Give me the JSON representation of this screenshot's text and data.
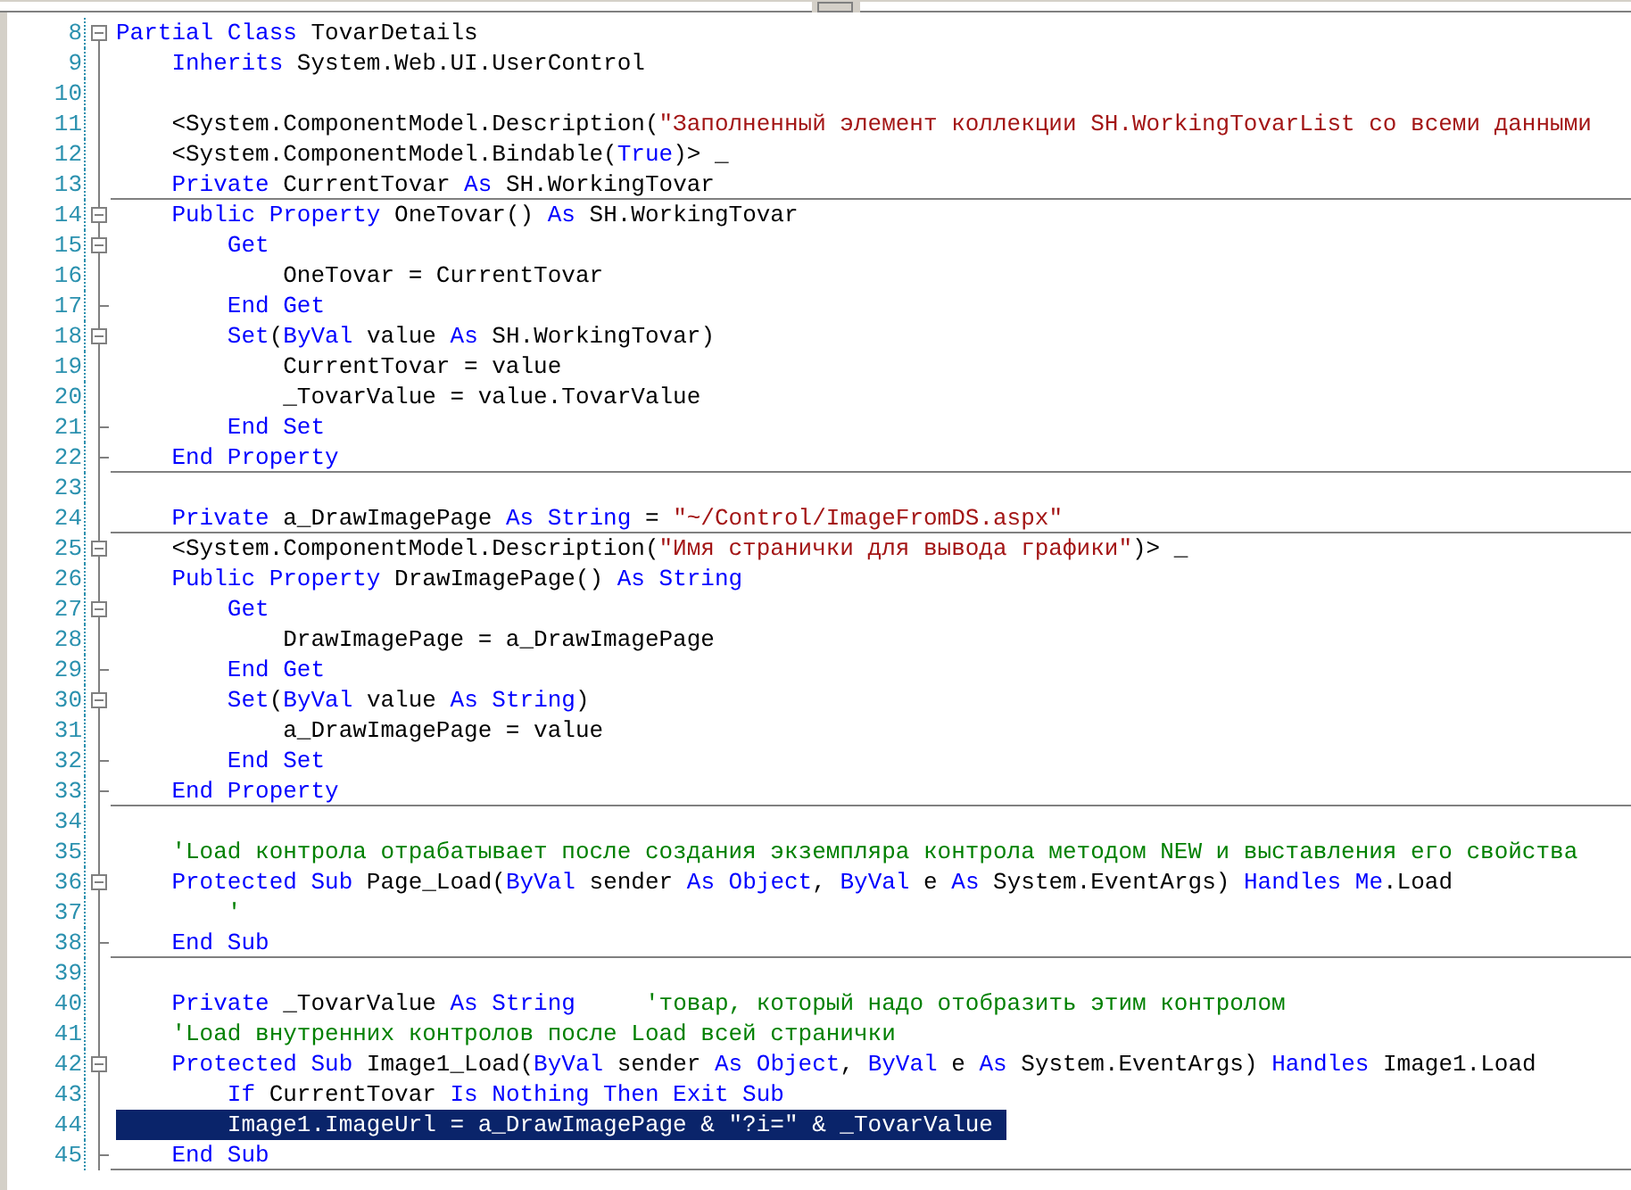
{
  "lines": [
    {
      "number": "8",
      "fold_box": true,
      "fold_end": false,
      "separator_below": false,
      "selected": false,
      "segments": [
        {
          "kind": "keyword",
          "text": "Partial Class"
        },
        {
          "kind": "plain",
          "text": " TovarDetails"
        }
      ]
    },
    {
      "number": "9",
      "fold_box": false,
      "fold_end": false,
      "separator_below": false,
      "selected": false,
      "segments": [
        {
          "kind": "keyword",
          "text": "    Inherits"
        },
        {
          "kind": "plain",
          "text": " System.Web.UI.UserControl"
        }
      ]
    },
    {
      "number": "10",
      "fold_box": false,
      "fold_end": false,
      "separator_below": false,
      "selected": false
    },
    {
      "number": "11",
      "fold_box": false,
      "fold_end": false,
      "separator_below": false,
      "selected": false,
      "segments": [
        {
          "kind": "plain",
          "text": "    <System.ComponentModel.Description("
        },
        {
          "kind": "string",
          "text": "\"Заполненный элемент коллекции SH.WorkingTovarList со всеми данными"
        }
      ]
    },
    {
      "number": "12",
      "fold_box": false,
      "fold_end": false,
      "separator_below": false,
      "selected": false,
      "segments": [
        {
          "kind": "plain",
          "text": "    <System.ComponentModel.Bindable("
        },
        {
          "kind": "keyword",
          "text": "True"
        },
        {
          "kind": "plain",
          "text": ")> _"
        }
      ]
    },
    {
      "number": "13",
      "fold_box": false,
      "fold_end": false,
      "separator_below": true,
      "selected": false,
      "segments": [
        {
          "kind": "keyword",
          "text": "    Private"
        },
        {
          "kind": "plain",
          "text": " CurrentTovar "
        },
        {
          "kind": "keyword",
          "text": "As"
        },
        {
          "kind": "plain",
          "text": " SH.WorkingTovar"
        }
      ]
    },
    {
      "number": "14",
      "fold_box": true,
      "fold_end": false,
      "separator_below": false,
      "selected": false,
      "segments": [
        {
          "kind": "keyword",
          "text": "    Public Property"
        },
        {
          "kind": "plain",
          "text": " OneTovar() "
        },
        {
          "kind": "keyword",
          "text": "As"
        },
        {
          "kind": "plain",
          "text": " SH.WorkingTovar"
        }
      ]
    },
    {
      "number": "15",
      "fold_box": true,
      "fold_end": false,
      "separator_below": false,
      "selected": false,
      "segments": [
        {
          "kind": "keyword",
          "text": "        Get"
        }
      ]
    },
    {
      "number": "16",
      "fold_box": false,
      "fold_end": false,
      "separator_below": false,
      "selected": false,
      "segments": [
        {
          "kind": "plain",
          "text": "            OneTovar = CurrentTovar"
        }
      ]
    },
    {
      "number": "17",
      "fold_box": false,
      "fold_end": true,
      "separator_below": false,
      "selected": false,
      "segments": [
        {
          "kind": "keyword",
          "text": "        End Get"
        }
      ]
    },
    {
      "number": "18",
      "fold_box": true,
      "fold_end": false,
      "separator_below": false,
      "selected": false,
      "segments": [
        {
          "kind": "keyword",
          "text": "        Set"
        },
        {
          "kind": "plain",
          "text": "("
        },
        {
          "kind": "keyword",
          "text": "ByVal"
        },
        {
          "kind": "plain",
          "text": " value "
        },
        {
          "kind": "keyword",
          "text": "As"
        },
        {
          "kind": "plain",
          "text": " SH.WorkingTovar)"
        }
      ]
    },
    {
      "number": "19",
      "fold_box": false,
      "fold_end": false,
      "separator_below": false,
      "selected": false,
      "segments": [
        {
          "kind": "plain",
          "text": "            CurrentTovar = value"
        }
      ]
    },
    {
      "number": "20",
      "fold_box": false,
      "fold_end": false,
      "separator_below": false,
      "selected": false,
      "segments": [
        {
          "kind": "plain",
          "text": "            _TovarValue = value.TovarValue"
        }
      ]
    },
    {
      "number": "21",
      "fold_box": false,
      "fold_end": true,
      "separator_below": false,
      "selected": false,
      "segments": [
        {
          "kind": "keyword",
          "text": "        End Set"
        }
      ]
    },
    {
      "number": "22",
      "fold_box": false,
      "fold_end": true,
      "separator_below": true,
      "selected": false,
      "segments": [
        {
          "kind": "keyword",
          "text": "    End Property"
        }
      ]
    },
    {
      "number": "23",
      "fold_box": false,
      "fold_end": false,
      "separator_below": false,
      "selected": false
    },
    {
      "number": "24",
      "fold_box": false,
      "fold_end": false,
      "separator_below": true,
      "selected": false,
      "segments": [
        {
          "kind": "keyword",
          "text": "    Private"
        },
        {
          "kind": "plain",
          "text": " a_DrawImagePage "
        },
        {
          "kind": "keyword",
          "text": "As String"
        },
        {
          "kind": "plain",
          "text": " = "
        },
        {
          "kind": "string",
          "text": "\"~/Control/ImageFromDS.aspx\""
        }
      ]
    },
    {
      "number": "25",
      "fold_box": true,
      "fold_end": false,
      "separator_below": false,
      "selected": false,
      "segments": [
        {
          "kind": "plain",
          "text": "    <System.ComponentModel.Description("
        },
        {
          "kind": "string",
          "text": "\"Имя странички для вывода графики\""
        },
        {
          "kind": "plain",
          "text": ")> _"
        }
      ]
    },
    {
      "number": "26",
      "fold_box": false,
      "fold_end": false,
      "separator_below": false,
      "selected": false,
      "segments": [
        {
          "kind": "keyword",
          "text": "    Public Property"
        },
        {
          "kind": "plain",
          "text": " DrawImagePage() "
        },
        {
          "kind": "keyword",
          "text": "As String"
        }
      ]
    },
    {
      "number": "27",
      "fold_box": true,
      "fold_end": false,
      "separator_below": false,
      "selected": false,
      "segments": [
        {
          "kind": "keyword",
          "text": "        Get"
        }
      ]
    },
    {
      "number": "28",
      "fold_box": false,
      "fold_end": false,
      "separator_below": false,
      "selected": false,
      "segments": [
        {
          "kind": "plain",
          "text": "            DrawImagePage = a_DrawImagePage"
        }
      ]
    },
    {
      "number": "29",
      "fold_box": false,
      "fold_end": true,
      "separator_below": false,
      "selected": false,
      "segments": [
        {
          "kind": "keyword",
          "text": "        End Get"
        }
      ]
    },
    {
      "number": "30",
      "fold_box": true,
      "fold_end": false,
      "separator_below": false,
      "selected": false,
      "segments": [
        {
          "kind": "keyword",
          "text": "        Set"
        },
        {
          "kind": "plain",
          "text": "("
        },
        {
          "kind": "keyword",
          "text": "ByVal"
        },
        {
          "kind": "plain",
          "text": " value "
        },
        {
          "kind": "keyword",
          "text": "As String"
        },
        {
          "kind": "plain",
          "text": ")"
        }
      ]
    },
    {
      "number": "31",
      "fold_box": false,
      "fold_end": false,
      "separator_below": false,
      "selected": false,
      "segments": [
        {
          "kind": "plain",
          "text": "            a_DrawImagePage = value"
        }
      ]
    },
    {
      "number": "32",
      "fold_box": false,
      "fold_end": true,
      "separator_below": false,
      "selected": false,
      "segments": [
        {
          "kind": "keyword",
          "text": "        End Set"
        }
      ]
    },
    {
      "number": "33",
      "fold_box": false,
      "fold_end": true,
      "separator_below": true,
      "selected": false,
      "segments": [
        {
          "kind": "keyword",
          "text": "    End Property"
        }
      ]
    },
    {
      "number": "34",
      "fold_box": false,
      "fold_end": false,
      "separator_below": false,
      "selected": false
    },
    {
      "number": "35",
      "fold_box": false,
      "fold_end": false,
      "separator_below": false,
      "selected": false,
      "segments": [
        {
          "kind": "comment",
          "text": "    'Load контрола отрабатывает после создания экземпляра контрола методом NEW и выставления его свойства"
        }
      ]
    },
    {
      "number": "36",
      "fold_box": true,
      "fold_end": false,
      "separator_below": false,
      "selected": false,
      "segments": [
        {
          "kind": "keyword",
          "text": "    Protected Sub"
        },
        {
          "kind": "plain",
          "text": " Page_Load("
        },
        {
          "kind": "keyword",
          "text": "ByVal"
        },
        {
          "kind": "plain",
          "text": " sender "
        },
        {
          "kind": "keyword",
          "text": "As Object"
        },
        {
          "kind": "plain",
          "text": ", "
        },
        {
          "kind": "keyword",
          "text": "ByVal"
        },
        {
          "kind": "plain",
          "text": " e "
        },
        {
          "kind": "keyword",
          "text": "As"
        },
        {
          "kind": "plain",
          "text": " System.EventArgs) "
        },
        {
          "kind": "keyword",
          "text": "Handles Me"
        },
        {
          "kind": "plain",
          "text": ".Load"
        }
      ]
    },
    {
      "number": "37",
      "fold_box": false,
      "fold_end": false,
      "separator_below": false,
      "selected": false,
      "segments": [
        {
          "kind": "comment",
          "text": "        '"
        }
      ]
    },
    {
      "number": "38",
      "fold_box": false,
      "fold_end": true,
      "separator_below": true,
      "selected": false,
      "segments": [
        {
          "kind": "keyword",
          "text": "    End Sub"
        }
      ]
    },
    {
      "number": "39",
      "fold_box": false,
      "fold_end": false,
      "separator_below": false,
      "selected": false
    },
    {
      "number": "40",
      "fold_box": false,
      "fold_end": false,
      "separator_below": false,
      "selected": false,
      "segments": [
        {
          "kind": "keyword",
          "text": "    Private"
        },
        {
          "kind": "plain",
          "text": " _TovarValue "
        },
        {
          "kind": "keyword",
          "text": "As String"
        },
        {
          "kind": "comment",
          "text": "     'товар, который надо отобразить этим контролом"
        }
      ]
    },
    {
      "number": "41",
      "fold_box": false,
      "fold_end": false,
      "separator_below": false,
      "selected": false,
      "segments": [
        {
          "kind": "comment",
          "text": "    'Load внутренних контролов после Load всей странички"
        }
      ]
    },
    {
      "number": "42",
      "fold_box": true,
      "fold_end": false,
      "separator_below": false,
      "selected": false,
      "segments": [
        {
          "kind": "keyword",
          "text": "    Protected Sub"
        },
        {
          "kind": "plain",
          "text": " Image1_Load("
        },
        {
          "kind": "keyword",
          "text": "ByVal"
        },
        {
          "kind": "plain",
          "text": " sender "
        },
        {
          "kind": "keyword",
          "text": "As Object"
        },
        {
          "kind": "plain",
          "text": ", "
        },
        {
          "kind": "keyword",
          "text": "ByVal"
        },
        {
          "kind": "plain",
          "text": " e "
        },
        {
          "kind": "keyword",
          "text": "As"
        },
        {
          "kind": "plain",
          "text": " System.EventArgs) "
        },
        {
          "kind": "keyword",
          "text": "Handles"
        },
        {
          "kind": "plain",
          "text": " Image1.Load"
        }
      ]
    },
    {
      "number": "43",
      "fold_box": false,
      "fold_end": false,
      "separator_below": false,
      "selected": false,
      "segments": [
        {
          "kind": "keyword",
          "text": "        If"
        },
        {
          "kind": "plain",
          "text": " CurrentTovar "
        },
        {
          "kind": "keyword",
          "text": "Is Nothing Then Exit Sub"
        }
      ]
    },
    {
      "number": "44",
      "fold_box": false,
      "fold_end": false,
      "separator_below": false,
      "selected": true,
      "segments": [
        {
          "kind": "plain",
          "text": "        Image1.ImageUrl = a_DrawImagePage & \"?i=\" & _TovarValue"
        }
      ]
    },
    {
      "number": "45",
      "fold_box": false,
      "fold_end": true,
      "separator_below": true,
      "selected": false,
      "segments": [
        {
          "kind": "keyword",
          "text": "    End Sub"
        }
      ]
    }
  ]
}
